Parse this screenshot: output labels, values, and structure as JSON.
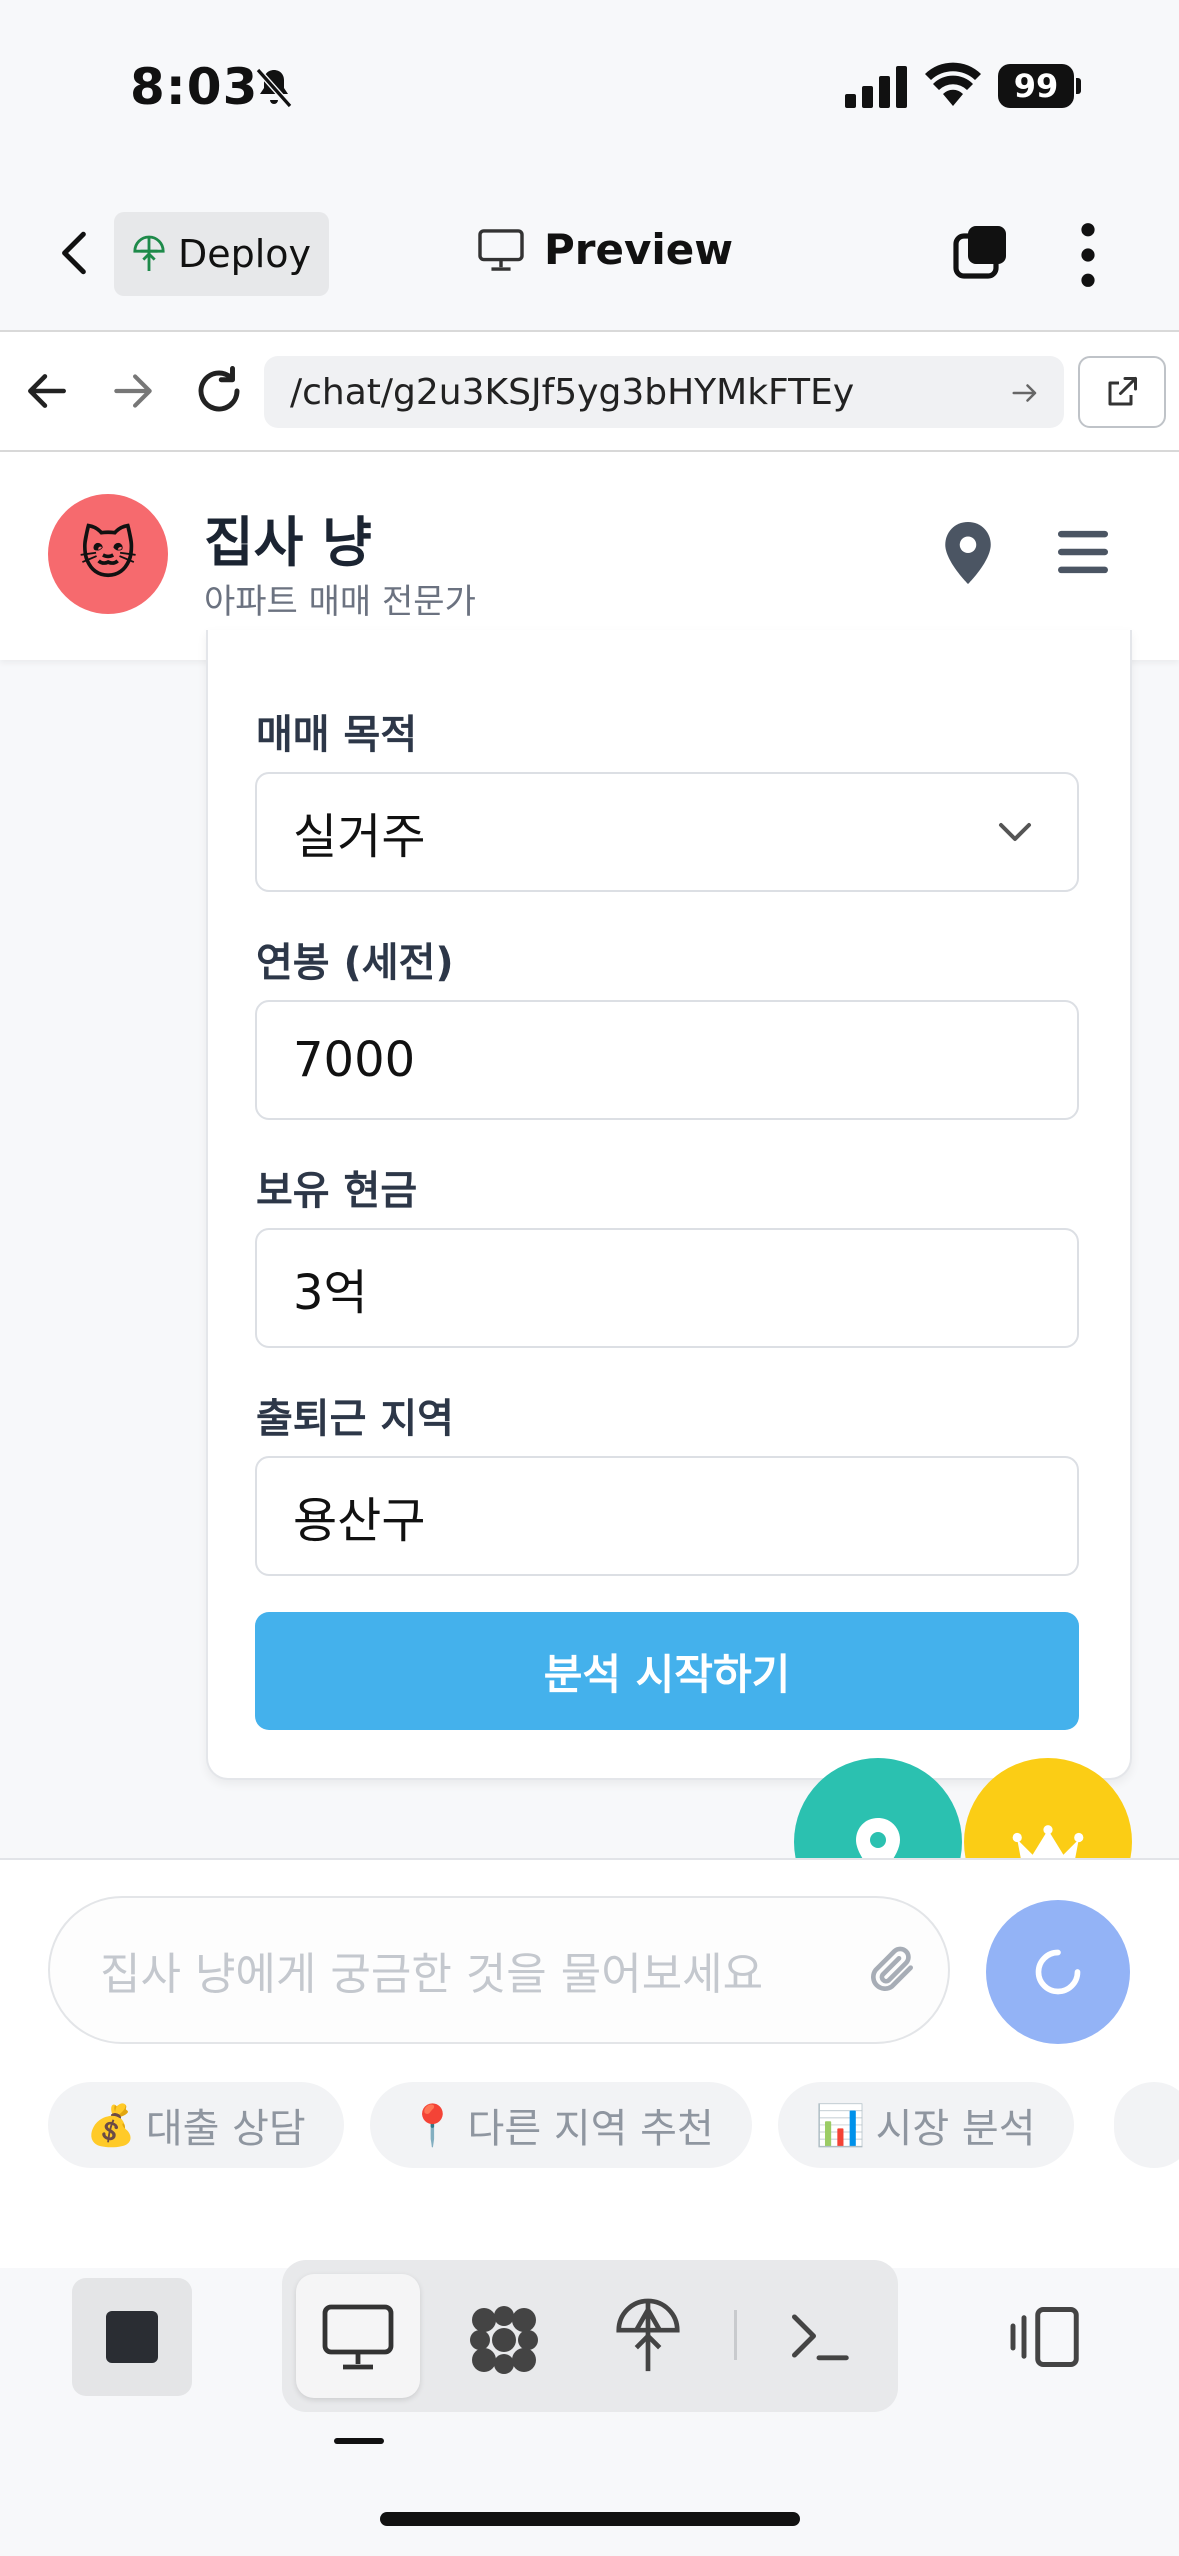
{
  "status_bar": {
    "time": "8:03",
    "battery": "99"
  },
  "app_header": {
    "deploy_label": "Deploy",
    "preview_label": "Preview"
  },
  "browser": {
    "url": "/chat/g2u3KSJf5yg3bHYMkFTEy"
  },
  "site": {
    "avatar_emoji": "🐱",
    "title": "집사 냥",
    "subtitle": "아파트 매매 전문가"
  },
  "form": {
    "purpose_label": "매매 목적",
    "purpose_value": "실거주",
    "salary_label": "연봉 (세전)",
    "salary_value": "7000",
    "cash_label": "보유 현금",
    "cash_value": "3억",
    "commute_label": "출퇴근 지역",
    "commute_value": "용산구",
    "submit_label": "분석 시작하기"
  },
  "chat": {
    "placeholder": "집사 냥에게 궁금한 것을 물어보세요",
    "chips": [
      {
        "emoji": "💰",
        "label": "대출 상담"
      },
      {
        "emoji": "📍",
        "label": "다른 지역 추천"
      },
      {
        "emoji": "📊",
        "label": "시장 분석"
      }
    ]
  },
  "colors": {
    "accent_blue": "#44b1ec",
    "avatar_red": "#f66a6e",
    "fab_teal": "#2bc1b0",
    "fab_yellow": "#fbcd15",
    "send_button": "#93b3f6"
  }
}
